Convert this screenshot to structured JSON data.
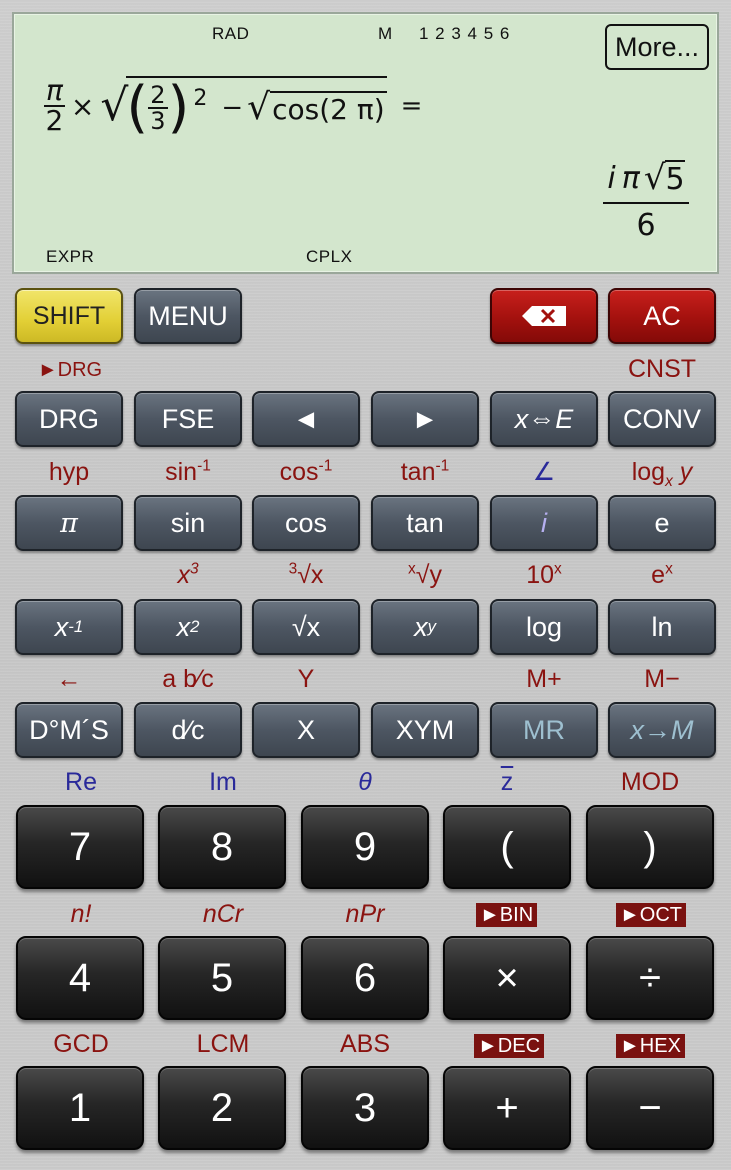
{
  "display": {
    "indicators": {
      "angle_mode": "RAD",
      "memory": "M",
      "variables": "1 2 3 4 5 6",
      "input_mode": "EXPR",
      "number_mode": "CPLX"
    },
    "more_button": "More...",
    "expression": {
      "pi_num": "π",
      "pi_den": "2",
      "times": "×",
      "two": "2",
      "three": "3",
      "power": "2",
      "minus": "−",
      "cos_arg": "cos(2 π)",
      "equals": "="
    },
    "result": {
      "numerator_i": "i",
      "numerator_pi": "π",
      "numerator_root": "5",
      "denominator": "6"
    }
  },
  "row0": {
    "shift": "SHIFT",
    "menu": "MENU",
    "backspace_icon": "backspace-icon",
    "ac": "AC",
    "shift_labels": {
      "drg_arrow": "►DRG",
      "cnst": "CNST"
    }
  },
  "row1": {
    "keys": [
      "DRG",
      "FSE",
      "◄",
      "►",
      "x⇔E",
      "CONV"
    ],
    "shift_labels": [
      "hyp",
      "sin-1",
      "cos-1",
      "tan-1",
      "∠",
      "logx y"
    ]
  },
  "row2": {
    "keys": [
      "π",
      "sin",
      "cos",
      "tan",
      "i",
      "e"
    ],
    "shift_labels": [
      "",
      "x3",
      "3√x",
      "x√y",
      "10x",
      "ex"
    ]
  },
  "row3": {
    "keys": [
      "x-1",
      "x2",
      "√x",
      "xy",
      "log",
      "ln"
    ],
    "shift_labels": [
      "←",
      "a b⁄c",
      "Y",
      "",
      "M+",
      "M−"
    ]
  },
  "row4": {
    "keys": [
      "D°M´S",
      "d⁄c",
      "X",
      "XYM",
      "MR",
      "x→M"
    ],
    "shift_labels": [
      "Re",
      "Im",
      "θ",
      "z",
      "MOD"
    ]
  },
  "row5": {
    "keys": [
      "7",
      "8",
      "9",
      "(",
      ")"
    ],
    "shift_labels": [
      "n!",
      "nCr",
      "nPr",
      "►BIN",
      "►OCT"
    ]
  },
  "row6": {
    "keys": [
      "4",
      "5",
      "6",
      "×",
      "÷"
    ],
    "shift_labels": [
      "GCD",
      "LCM",
      "ABS",
      "►DEC",
      "►HEX"
    ]
  },
  "row7": {
    "keys": [
      "1",
      "2",
      "3",
      "+",
      "−"
    ]
  },
  "colors": {
    "lcd_bg": "#d3e6cd",
    "shift_key": "#e2cf35",
    "red_key": "#a3110e",
    "gray_key": "#4d5662",
    "dark_key": "#262626",
    "shift_label": "#8a1310",
    "complex_label": "#2a2a9a"
  }
}
